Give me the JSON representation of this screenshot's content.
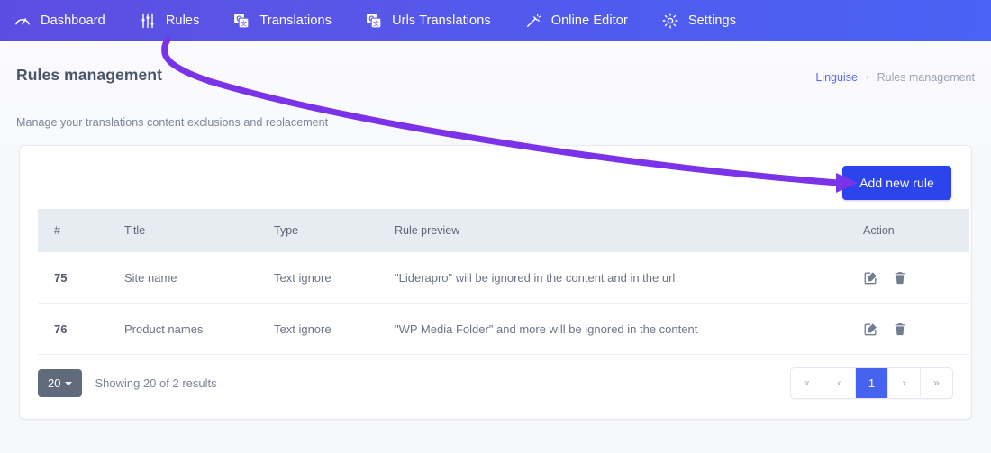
{
  "nav": {
    "items": [
      {
        "label": "Dashboard",
        "icon": "gauge-icon",
        "active": false
      },
      {
        "label": "Rules",
        "icon": "sliders-icon",
        "active": true
      },
      {
        "label": "Translations",
        "icon": "translate-icon",
        "active": false
      },
      {
        "label": "Urls Translations",
        "icon": "translate-icon",
        "active": false
      },
      {
        "label": "Online Editor",
        "icon": "magic-wand-icon",
        "active": false
      },
      {
        "label": "Settings",
        "icon": "gear-icon",
        "active": false
      }
    ]
  },
  "header": {
    "title": "Rules management",
    "subtitle": "Manage your translations content exclusions and replacement",
    "breadcrumb": {
      "root": "Linguise",
      "separator": "›",
      "current": "Rules management"
    }
  },
  "toolbar": {
    "add_rule_label": "Add new rule"
  },
  "table": {
    "columns": [
      "#",
      "Title",
      "Type",
      "Rule preview",
      "Action"
    ],
    "rows": [
      {
        "num": "75",
        "title": "Site name",
        "type": "Text ignore",
        "preview": "\"Liderapro\" will be ignored in the content and in the url",
        "edit_label": "edit-icon",
        "delete_label": "trash-icon"
      },
      {
        "num": "76",
        "title": "Product names",
        "type": "Text ignore",
        "preview": "\"WP Media Folder\" and more will be ignored in the content",
        "edit_label": "edit-icon",
        "delete_label": "trash-icon"
      }
    ]
  },
  "footer": {
    "per_page": "20",
    "showing": "Showing 20 of 2 results",
    "pagination": {
      "first": "«",
      "prev": "‹",
      "pages": [
        "1"
      ],
      "next": "›",
      "last": "»",
      "current": "1"
    }
  },
  "colors": {
    "nav_start": "#5b4de0",
    "nav_end": "#4a62f5",
    "primary_button": "#2b44ec",
    "accent_link": "#5b68f4",
    "annotation_arrow": "#7a33e8",
    "page_background": "#f7f8fc",
    "table_header": "#e7ebf2",
    "pagination_active": "#4663f0"
  },
  "annotation": {
    "type": "curved-arrow",
    "points_to": "add-new-rule-button"
  }
}
